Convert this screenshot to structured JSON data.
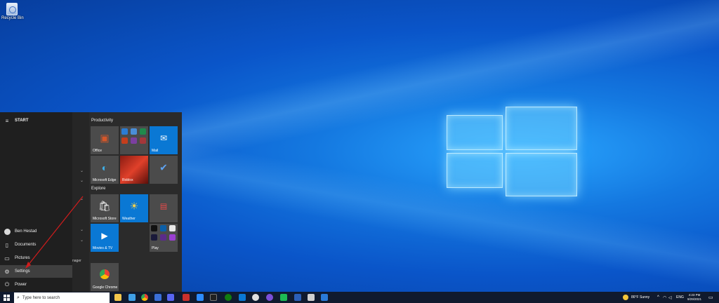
{
  "desktop": {
    "recycle_bin_label": "Recycle Bin"
  },
  "start_menu": {
    "title": "START",
    "rail": {
      "user": "Ben Hestad",
      "documents": "Documents",
      "pictures": "Pictures",
      "settings": "Settings",
      "power": "Power"
    },
    "list_fragment": "nager",
    "groups": {
      "productivity": "Productivity",
      "explore": "Explore"
    },
    "tiles": {
      "office": "Office",
      "mail": "Mail",
      "edge": "Microsoft Edge",
      "store": "Microsoft Store",
      "weather": "Weather",
      "movies": "Movies & TV",
      "play": "Play",
      "chrome": "Google Chrome",
      "game": "Roblox"
    }
  },
  "taskbar": {
    "search_placeholder": "Type here to search",
    "weather": "86°F  Sunny",
    "language": "ENG",
    "time": "4:23 PM",
    "date": "9/29/2021"
  },
  "colors": {
    "accent": "#0078d7",
    "tile_gray": "#4a4a4a",
    "annotation_arrow": "#d01c1c"
  }
}
